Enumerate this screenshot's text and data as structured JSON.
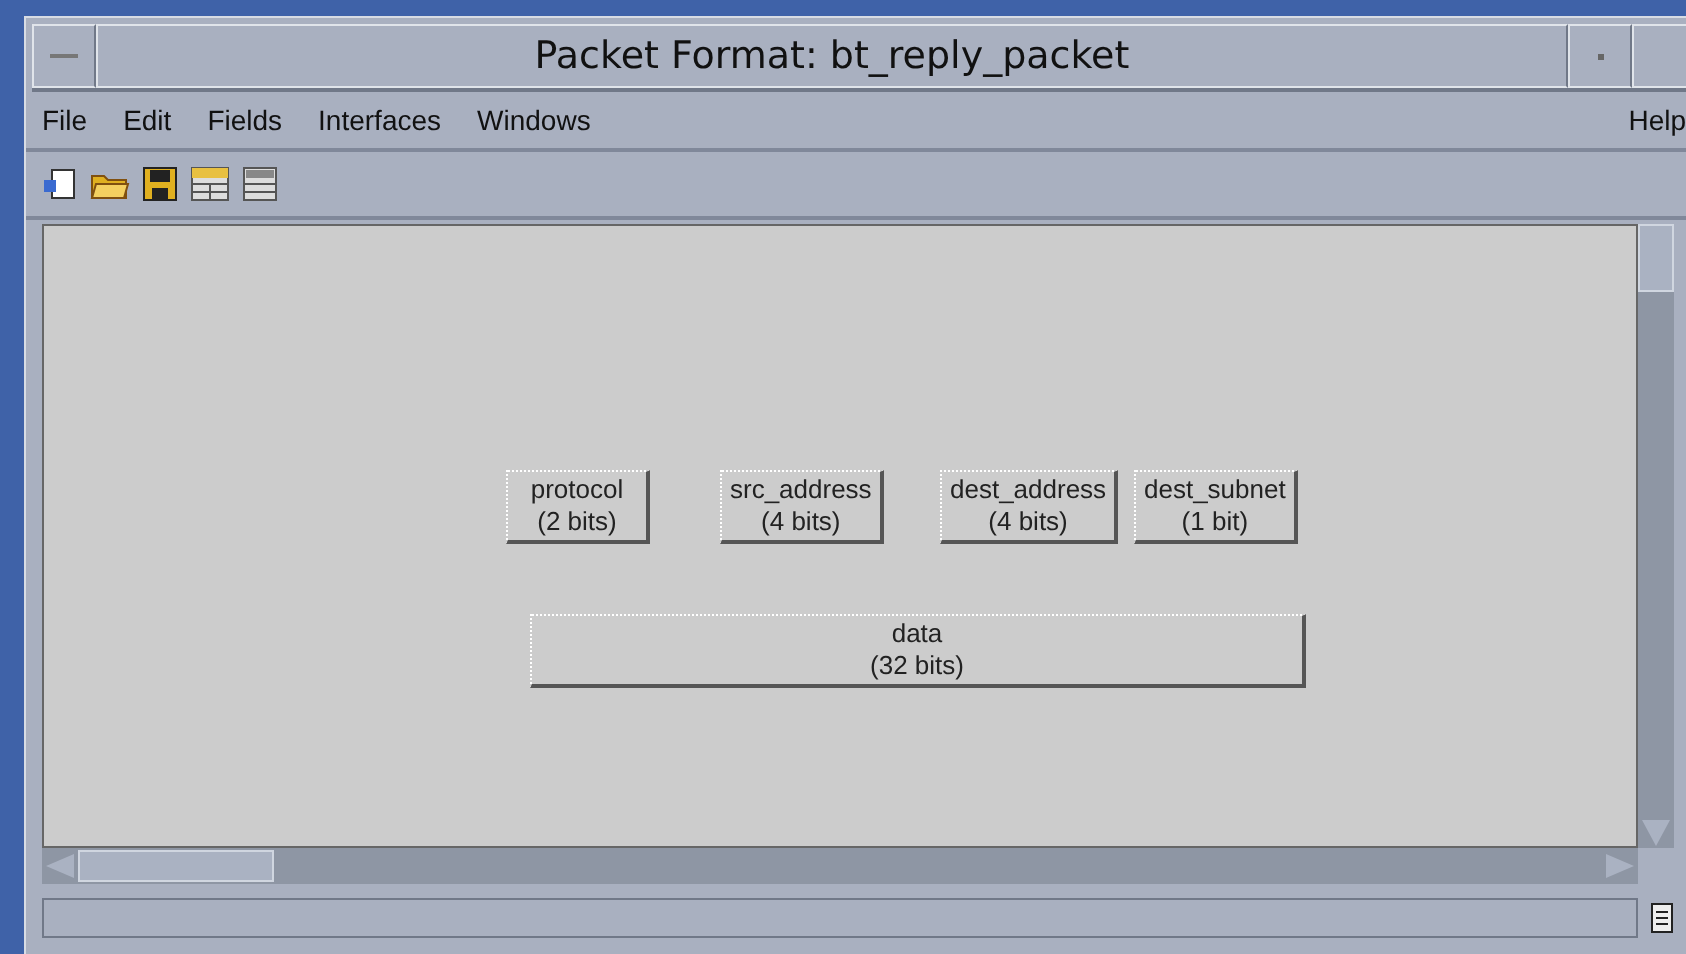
{
  "window": {
    "title": "Packet Format: bt_reply_packet"
  },
  "menu": [
    {
      "label": "File"
    },
    {
      "label": "Edit"
    },
    {
      "label": "Fields"
    },
    {
      "label": "Interfaces"
    },
    {
      "label": "Windows"
    }
  ],
  "help_menu": {
    "label": "Help"
  },
  "toolbar": [
    {
      "kind": "new"
    },
    {
      "kind": "open"
    },
    {
      "kind": "save"
    },
    {
      "kind": "fields"
    },
    {
      "kind": "attributes"
    }
  ],
  "fields": [
    {
      "name": "protocol",
      "size": "(2 bits)"
    },
    {
      "name": "src_address",
      "size": "(4 bits)"
    },
    {
      "name": "dest_address",
      "size": "(4 bits)"
    },
    {
      "name": "dest_subnet",
      "size": "(1 bit)"
    },
    {
      "name": "data",
      "size": "(32 bits)"
    }
  ]
}
